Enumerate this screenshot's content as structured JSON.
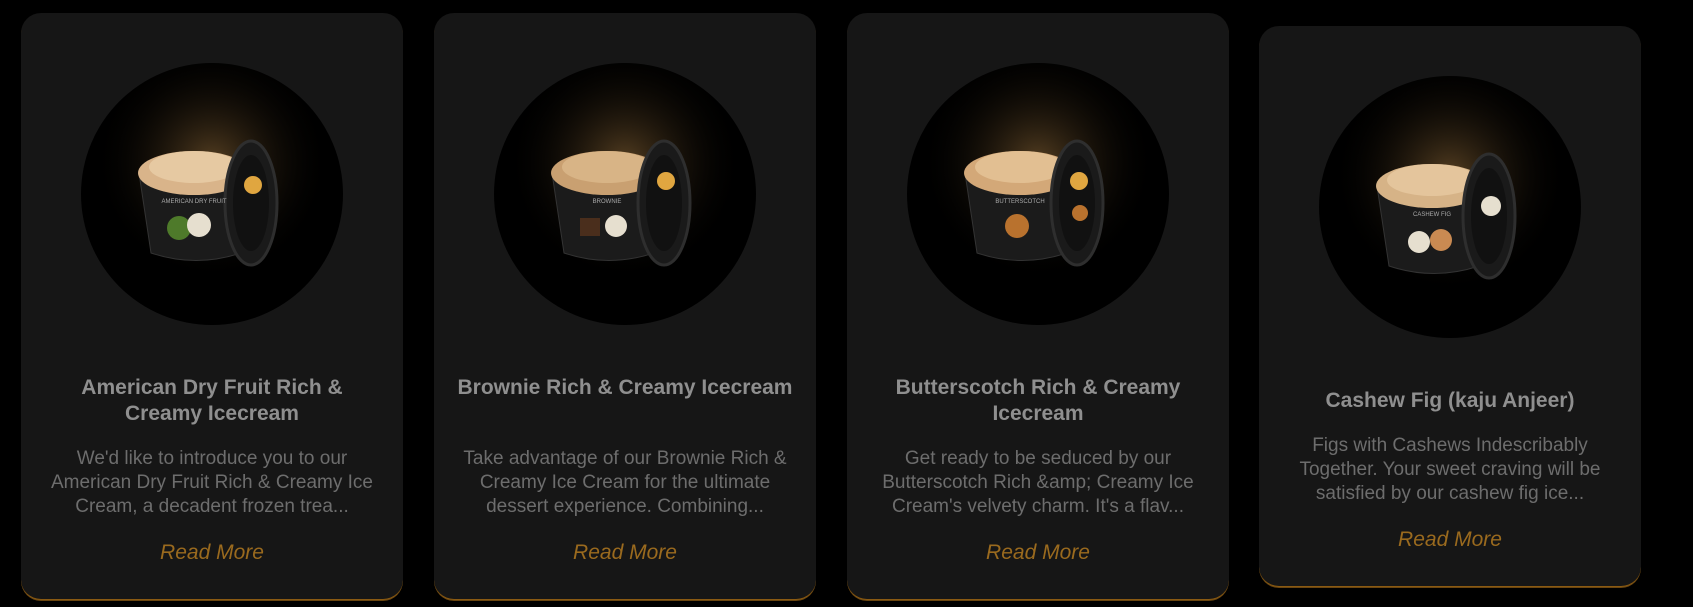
{
  "products": [
    {
      "title": "American Dry Fruit Rich & Creamy Icecream",
      "description": "We'd like to introduce you to our American Dry Fruit Rich & Creamy Ice Cream, a decadent frozen trea...",
      "cta": "Read More",
      "tub_label": "AMERICAN DRY FRUIT",
      "scoop_color": "#d9b48a",
      "accent_color": "#4e7a2a"
    },
    {
      "title": "Brownie Rich & Creamy Icecream",
      "description": "Take advantage of our Brownie Rich & Creamy Ice Cream for the ultimate dessert experience. Combining...",
      "cta": "Read More",
      "tub_label": "BROWNIE",
      "scoop_color": "#c9a071",
      "accent_color": "#4a2e1c"
    },
    {
      "title": "Butterscotch Rich & Creamy Icecream",
      "description": "Get ready to be seduced by our Butterscotch Rich &amp; Creamy Ice Cream's velvety charm. It's a flav...",
      "cta": "Read More",
      "tub_label": "BUTTERSCOTCH",
      "scoop_color": "#d3a878",
      "accent_color": "#b9722e"
    },
    {
      "title": "Cashew Fig (kaju Anjeer)",
      "description": "Figs with Cashews Indescribably Together. Your sweet craving will be satisfied by our cashew fig ice...",
      "cta": "Read More",
      "tub_label": "CASHEW FIG",
      "scoop_color": "#d6b387",
      "accent_color": "#c98a52"
    }
  ],
  "theme": {
    "background": "#000000",
    "card_background": "#161616",
    "title_color": "#8f8f8f",
    "text_color": "#6d6d6d",
    "accent": "#9a6a1e"
  }
}
